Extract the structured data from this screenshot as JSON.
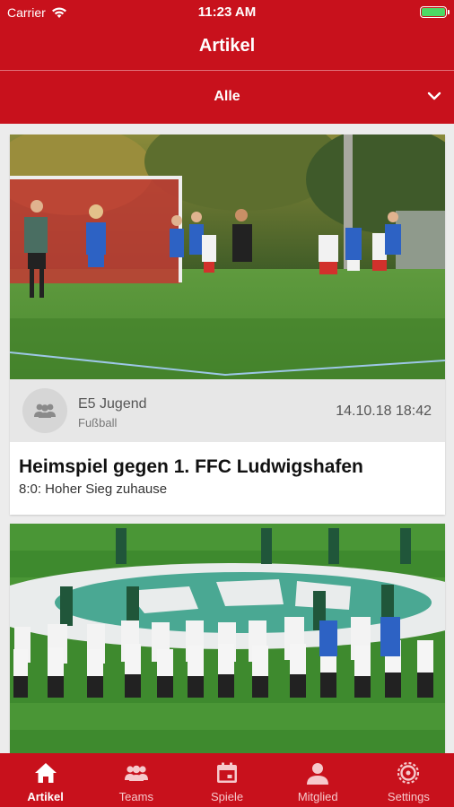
{
  "status_bar": {
    "carrier": "Carrier",
    "time": "11:23 AM",
    "battery_level": 1.0
  },
  "nav": {
    "title": "Artikel"
  },
  "filter": {
    "label": "Alle"
  },
  "articles": [
    {
      "team": "E5 Jugend",
      "sport": "Fußball",
      "date": "14.10.18 18:42",
      "title": "Heimspiel gegen 1. FFC Ludwigshafen",
      "subtitle": "8:0: Hoher Sieg zuhause"
    },
    {
      "team": "",
      "sport": "",
      "date": "",
      "title": "",
      "subtitle": ""
    }
  ],
  "tabs": [
    {
      "label": "Artikel",
      "icon": "home-icon",
      "active": true
    },
    {
      "label": "Teams",
      "icon": "teams-icon",
      "active": false
    },
    {
      "label": "Spiele",
      "icon": "calendar-icon",
      "active": false
    },
    {
      "label": "Mitglied",
      "icon": "person-icon",
      "active": false
    },
    {
      "label": "Settings",
      "icon": "gear-icon",
      "active": false
    }
  ],
  "colors": {
    "brand": "#c8111c",
    "card_meta_bg": "#e7e7e7",
    "page_bg": "#ececec"
  }
}
